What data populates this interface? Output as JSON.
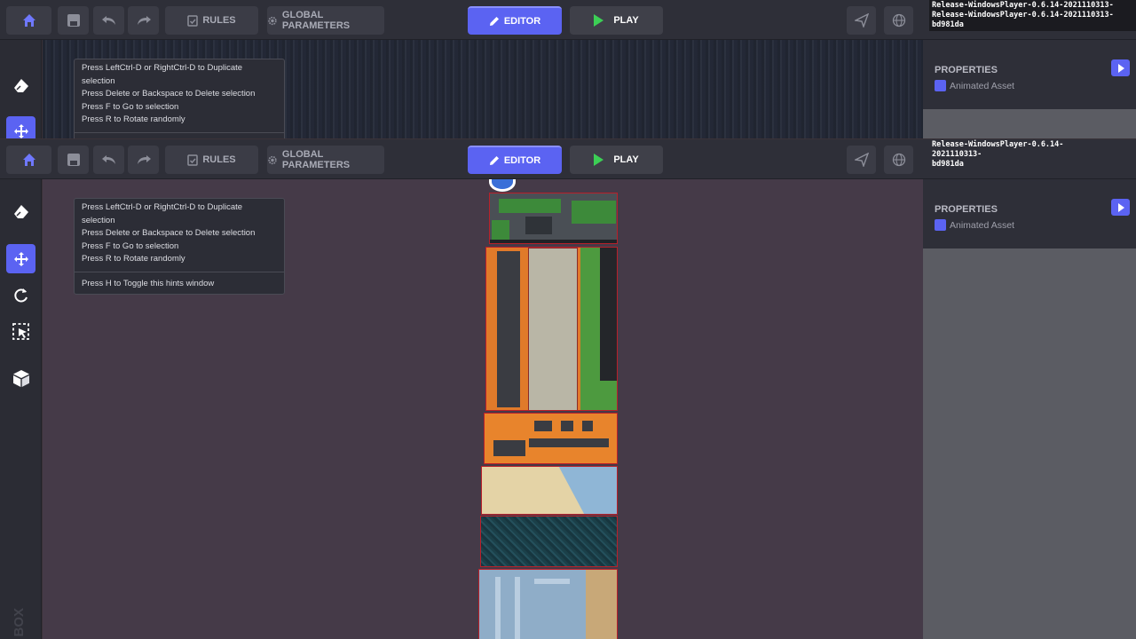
{
  "toolbar": {
    "rules_label": "RULES",
    "global_params_label": "GLOBAL PARAMETERS",
    "editor_label": "EDITOR",
    "play_label": "PLAY"
  },
  "version": {
    "top_line1": "Release-WindowsPlayer-0.6.14-2021110313-",
    "top_line2": "Release-WindowsPlayer-0.6.14-2021110313-",
    "top_line3": "bd981da",
    "main_line1": "Release-WindowsPlayer-0.6.14-2021110313-",
    "main_line2": "bd981da"
  },
  "hints": {
    "line1": "Press LeftCtrl-D or RightCtrl-D to Duplicate selection",
    "line2": "Press Delete or Backspace to Delete selection",
    "line3": "Press F to Go to selection",
    "line4": "Press R to Rotate randomly",
    "line5": "Press H to Toggle this hints window"
  },
  "properties": {
    "title": "PROPERTIES",
    "item_label": "Animated Asset"
  },
  "side_logo": "BOX"
}
